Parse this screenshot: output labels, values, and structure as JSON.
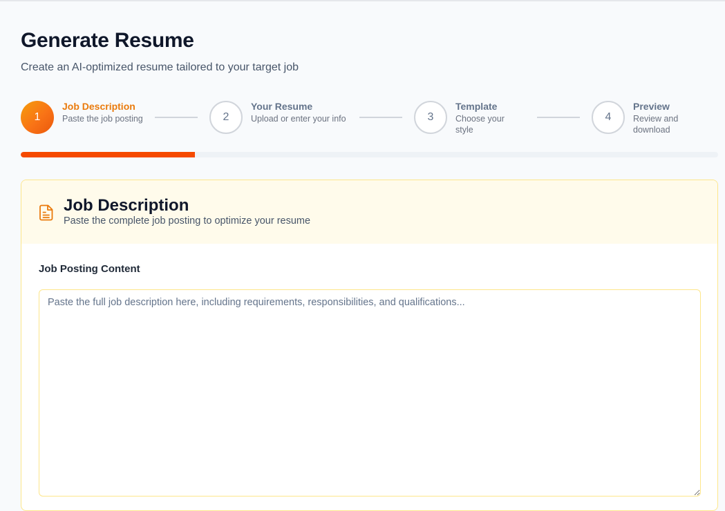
{
  "header": {
    "title": "Generate Resume",
    "subtitle": "Create an AI-optimized resume tailored to your target job"
  },
  "steps": [
    {
      "number": "1",
      "label": "Job Description",
      "desc": "Paste the job posting",
      "active": true
    },
    {
      "number": "2",
      "label": "Your Resume",
      "desc": "Upload or enter your info",
      "active": false
    },
    {
      "number": "3",
      "label": "Template",
      "desc": "Choose your style",
      "active": false
    },
    {
      "number": "4",
      "label": "Preview",
      "desc": "Review and download",
      "active": false
    }
  ],
  "progress": {
    "percent": 25,
    "color": "#f54a00"
  },
  "card": {
    "icon": "document-text-icon",
    "title": "Job Description",
    "subtitle": "Paste the complete job posting to optimize your resume",
    "field_label": "Job Posting Content",
    "textarea_value": "",
    "textarea_placeholder": "Paste the full job description here, including requirements, responsibilities, and qualifications..."
  },
  "colors": {
    "accent": "#f97316",
    "accent_text": "#ea7a0c",
    "card_border": "#fde68a",
    "card_header_bg": "#fffbeb"
  }
}
